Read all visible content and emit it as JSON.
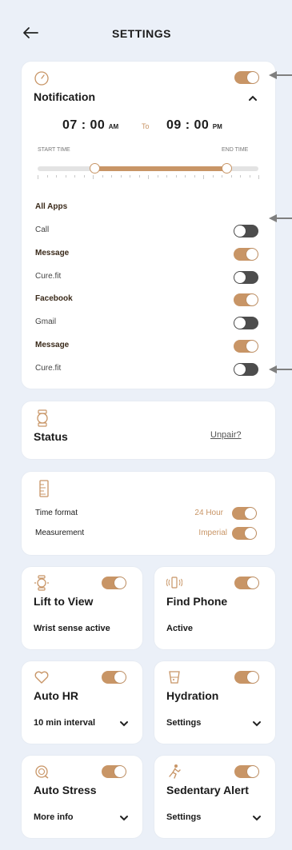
{
  "header": {
    "back_icon": "arrow-left-icon",
    "title": "SETTINGS"
  },
  "notification": {
    "icon": "clock-icon",
    "title": "Notification",
    "enabled": true,
    "start_time": "07 : 00",
    "start_ampm": "AM",
    "to_label": "To",
    "end_time": "09 : 00",
    "end_ampm": "PM",
    "start_label": "START TIME",
    "end_label": "END TIME",
    "range_start_fraction": 0.26,
    "range_end_fraction": 0.86,
    "all_apps_label": "All Apps",
    "apps": [
      {
        "label": "Call",
        "enabled": false
      },
      {
        "label": "Message",
        "enabled": true
      },
      {
        "label": "Cure.fit",
        "enabled": false
      },
      {
        "label": "Facebook",
        "enabled": true
      },
      {
        "label": "Gmail",
        "enabled": false
      },
      {
        "label": "Message",
        "enabled": true
      },
      {
        "label": "Cure.fit",
        "enabled": false
      }
    ]
  },
  "status": {
    "icon": "watch-icon",
    "title": "Status",
    "unpair_label": "Unpair?"
  },
  "format": {
    "icon": "ruler-icon",
    "time_label": "Time format",
    "time_value": "24 Hour",
    "measure_label": "Measurement",
    "measure_value": "Imperial"
  },
  "tiles": [
    {
      "icon": "wrist-watch-icon",
      "title": "Lift to View",
      "sub": "Wrist sense active",
      "has_dropdown": false,
      "enabled": true
    },
    {
      "icon": "vibrating-phone-icon",
      "title": "Find Phone",
      "sub": "Active",
      "has_dropdown": false,
      "enabled": true
    },
    {
      "icon": "heart-icon",
      "title": "Auto HR",
      "sub": "10 min interval",
      "has_dropdown": true,
      "enabled": true
    },
    {
      "icon": "water-glass-icon",
      "title": "Hydration",
      "sub": "Settings",
      "has_dropdown": true,
      "enabled": true
    },
    {
      "icon": "stress-icon",
      "title": "Auto Stress",
      "sub": "More info",
      "has_dropdown": true,
      "enabled": true
    },
    {
      "icon": "running-person-icon",
      "title": "Sedentary Alert",
      "sub": "Settings",
      "has_dropdown": true,
      "enabled": true
    }
  ],
  "colors": {
    "accent": "#c89566",
    "toggle_off": "#4d4d4d",
    "background": "#ebf0f8",
    "card": "#ffffff"
  }
}
